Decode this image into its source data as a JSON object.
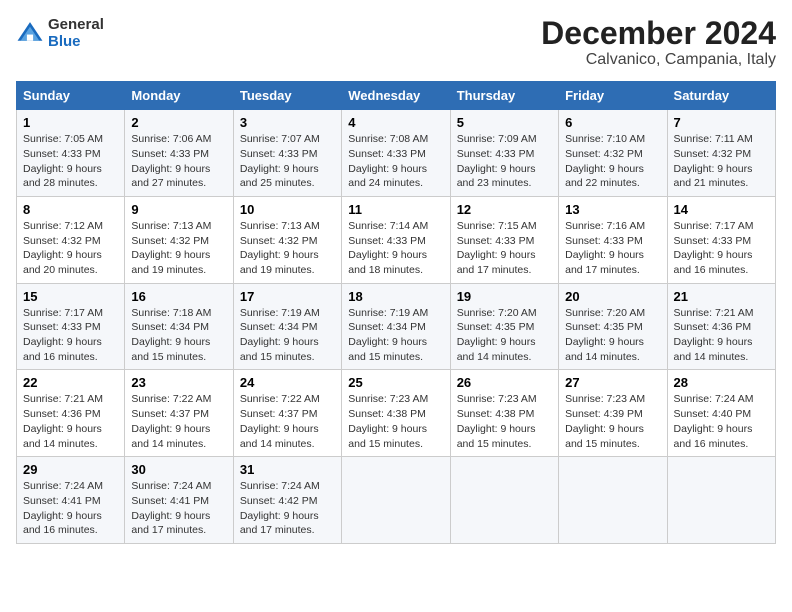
{
  "logo": {
    "general": "General",
    "blue": "Blue"
  },
  "title": {
    "month": "December 2024",
    "location": "Calvanico, Campania, Italy"
  },
  "weekdays": [
    "Sunday",
    "Monday",
    "Tuesday",
    "Wednesday",
    "Thursday",
    "Friday",
    "Saturday"
  ],
  "weeks": [
    [
      {
        "day": "1",
        "sunrise": "7:05 AM",
        "sunset": "4:33 PM",
        "daylight": "9 hours and 28 minutes."
      },
      {
        "day": "2",
        "sunrise": "7:06 AM",
        "sunset": "4:33 PM",
        "daylight": "9 hours and 27 minutes."
      },
      {
        "day": "3",
        "sunrise": "7:07 AM",
        "sunset": "4:33 PM",
        "daylight": "9 hours and 25 minutes."
      },
      {
        "day": "4",
        "sunrise": "7:08 AM",
        "sunset": "4:33 PM",
        "daylight": "9 hours and 24 minutes."
      },
      {
        "day": "5",
        "sunrise": "7:09 AM",
        "sunset": "4:33 PM",
        "daylight": "9 hours and 23 minutes."
      },
      {
        "day": "6",
        "sunrise": "7:10 AM",
        "sunset": "4:32 PM",
        "daylight": "9 hours and 22 minutes."
      },
      {
        "day": "7",
        "sunrise": "7:11 AM",
        "sunset": "4:32 PM",
        "daylight": "9 hours and 21 minutes."
      }
    ],
    [
      {
        "day": "8",
        "sunrise": "7:12 AM",
        "sunset": "4:32 PM",
        "daylight": "9 hours and 20 minutes."
      },
      {
        "day": "9",
        "sunrise": "7:13 AM",
        "sunset": "4:32 PM",
        "daylight": "9 hours and 19 minutes."
      },
      {
        "day": "10",
        "sunrise": "7:13 AM",
        "sunset": "4:32 PM",
        "daylight": "9 hours and 19 minutes."
      },
      {
        "day": "11",
        "sunrise": "7:14 AM",
        "sunset": "4:33 PM",
        "daylight": "9 hours and 18 minutes."
      },
      {
        "day": "12",
        "sunrise": "7:15 AM",
        "sunset": "4:33 PM",
        "daylight": "9 hours and 17 minutes."
      },
      {
        "day": "13",
        "sunrise": "7:16 AM",
        "sunset": "4:33 PM",
        "daylight": "9 hours and 17 minutes."
      },
      {
        "day": "14",
        "sunrise": "7:17 AM",
        "sunset": "4:33 PM",
        "daylight": "9 hours and 16 minutes."
      }
    ],
    [
      {
        "day": "15",
        "sunrise": "7:17 AM",
        "sunset": "4:33 PM",
        "daylight": "9 hours and 16 minutes."
      },
      {
        "day": "16",
        "sunrise": "7:18 AM",
        "sunset": "4:34 PM",
        "daylight": "9 hours and 15 minutes."
      },
      {
        "day": "17",
        "sunrise": "7:19 AM",
        "sunset": "4:34 PM",
        "daylight": "9 hours and 15 minutes."
      },
      {
        "day": "18",
        "sunrise": "7:19 AM",
        "sunset": "4:34 PM",
        "daylight": "9 hours and 15 minutes."
      },
      {
        "day": "19",
        "sunrise": "7:20 AM",
        "sunset": "4:35 PM",
        "daylight": "9 hours and 14 minutes."
      },
      {
        "day": "20",
        "sunrise": "7:20 AM",
        "sunset": "4:35 PM",
        "daylight": "9 hours and 14 minutes."
      },
      {
        "day": "21",
        "sunrise": "7:21 AM",
        "sunset": "4:36 PM",
        "daylight": "9 hours and 14 minutes."
      }
    ],
    [
      {
        "day": "22",
        "sunrise": "7:21 AM",
        "sunset": "4:36 PM",
        "daylight": "9 hours and 14 minutes."
      },
      {
        "day": "23",
        "sunrise": "7:22 AM",
        "sunset": "4:37 PM",
        "daylight": "9 hours and 14 minutes."
      },
      {
        "day": "24",
        "sunrise": "7:22 AM",
        "sunset": "4:37 PM",
        "daylight": "9 hours and 14 minutes."
      },
      {
        "day": "25",
        "sunrise": "7:23 AM",
        "sunset": "4:38 PM",
        "daylight": "9 hours and 15 minutes."
      },
      {
        "day": "26",
        "sunrise": "7:23 AM",
        "sunset": "4:38 PM",
        "daylight": "9 hours and 15 minutes."
      },
      {
        "day": "27",
        "sunrise": "7:23 AM",
        "sunset": "4:39 PM",
        "daylight": "9 hours and 15 minutes."
      },
      {
        "day": "28",
        "sunrise": "7:24 AM",
        "sunset": "4:40 PM",
        "daylight": "9 hours and 16 minutes."
      }
    ],
    [
      {
        "day": "29",
        "sunrise": "7:24 AM",
        "sunset": "4:41 PM",
        "daylight": "9 hours and 16 minutes."
      },
      {
        "day": "30",
        "sunrise": "7:24 AM",
        "sunset": "4:41 PM",
        "daylight": "9 hours and 17 minutes."
      },
      {
        "day": "31",
        "sunrise": "7:24 AM",
        "sunset": "4:42 PM",
        "daylight": "9 hours and 17 minutes."
      },
      null,
      null,
      null,
      null
    ]
  ],
  "labels": {
    "sunrise": "Sunrise:",
    "sunset": "Sunset:",
    "daylight": "Daylight:"
  }
}
